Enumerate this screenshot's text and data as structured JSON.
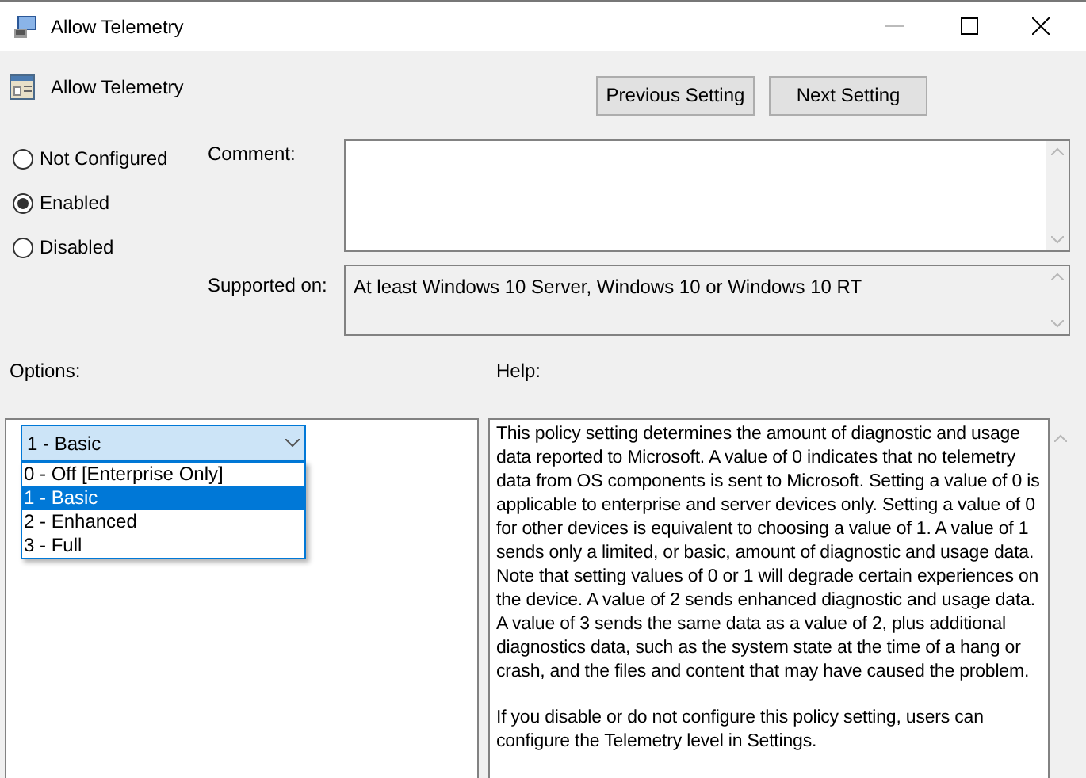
{
  "window": {
    "title": "Allow Telemetry"
  },
  "header": {
    "title": "Allow Telemetry"
  },
  "buttons": [
    {
      "label": "Previous Setting"
    },
    {
      "label": "Next Setting"
    }
  ],
  "state_options": [
    {
      "label": "Not Configured",
      "selected": false
    },
    {
      "label": "Enabled",
      "selected": true
    },
    {
      "label": "Disabled",
      "selected": false
    }
  ],
  "comment": {
    "label": "Comment:"
  },
  "supported_on": {
    "label": "Supported on:",
    "value": "At least Windows 10 Server, Windows 10 or Windows 10 RT"
  },
  "options": {
    "label": "Options:",
    "dropdown": {
      "value": "1 - Basic",
      "expanded": true,
      "items": [
        {
          "label": "0 - Off [Enterprise Only]",
          "selected": false
        },
        {
          "label": "1 - Basic",
          "selected": true
        },
        {
          "label": "2 - Enhanced",
          "selected": false
        },
        {
          "label": "3 - Full",
          "selected": false
        }
      ]
    }
  },
  "help": {
    "label": "Help:",
    "paragraphs": [
      "This policy setting determines the amount of diagnostic and usage data reported to Microsoft. A value of 0 indicates that no telemetry data from OS components is sent to Microsoft. Setting a value of 0 is applicable to enterprise and server devices only. Setting a value of 0 for other devices is equivalent to choosing a value of 1. A value of 1 sends only a limited, or basic, amount of diagnostic and usage data. Note that setting values of 0 or 1 will degrade certain experiences on the device. A value of 2 sends enhanced diagnostic and usage data. A value of 3 sends the same data as a value of 2, plus additional diagnostics data, such as the system state at the time of a hang or crash, and the files and content that may have caused the problem.",
      "If you disable or do not configure this policy setting, users can configure the Telemetry level in Settings."
    ]
  }
}
